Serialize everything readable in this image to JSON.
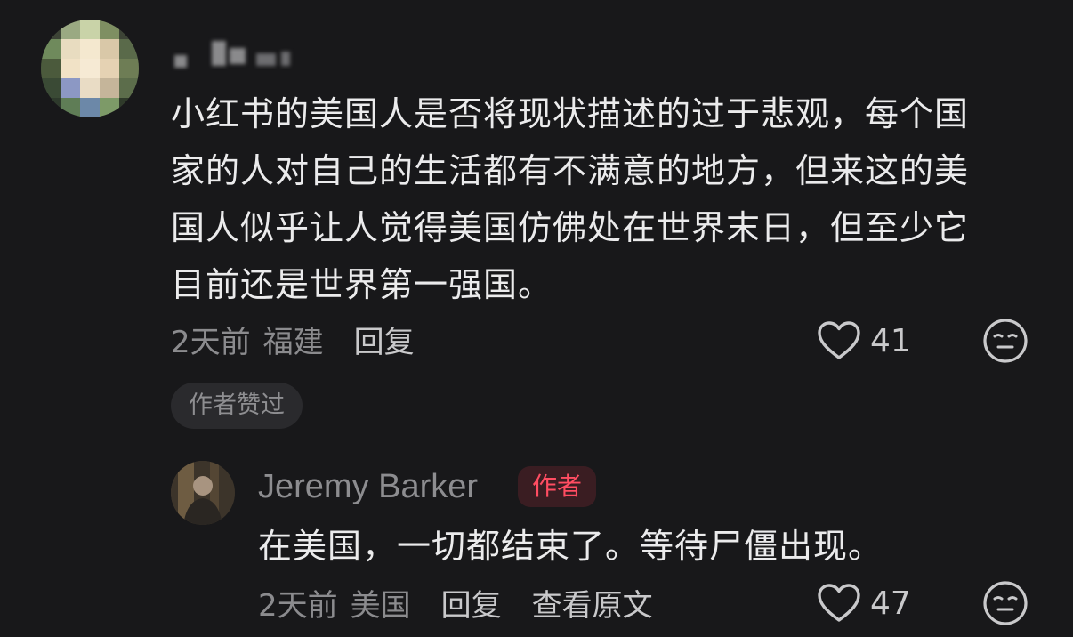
{
  "comment": {
    "username": "",
    "text": "小红书的美国人是否将现状描述的过于悲观，每个国家的人对自己的生活都有不满意的地方，但来这的美国人似乎让人觉得美国仿佛处在世界末日，但至少它目前还是世界第一强国。",
    "lines": [
      "小红书的美国人是否将现状描述的过于悲观，每个国",
      "家的人对自己的生活都有不满意的地方，但来这的美",
      "国人似乎让人觉得美国仿佛处在世界末日，但至少它",
      "目前还是世界第一强国。"
    ],
    "time": "2天前",
    "location": "福建",
    "reply_label": "回复",
    "likes": "41",
    "author_liked_label": "作者赞过",
    "like_icon": "heart-outline-icon",
    "emoji_icon": "emoji-face-icon"
  },
  "reply": {
    "username": "Jeremy Barker",
    "badge": "作者",
    "text": "在美国，一切都结束了。等待尸僵出现。",
    "time": "2天前",
    "location": "美国",
    "reply_label": "回复",
    "view_original_label": "查看原文",
    "likes": "47"
  },
  "colors": {
    "background": "#18181a",
    "primary_text": "#ebebec",
    "secondary_text": "#8b8b8e",
    "author_badge_text": "#ff4d62",
    "author_badge_bg": "#3a1d22"
  }
}
